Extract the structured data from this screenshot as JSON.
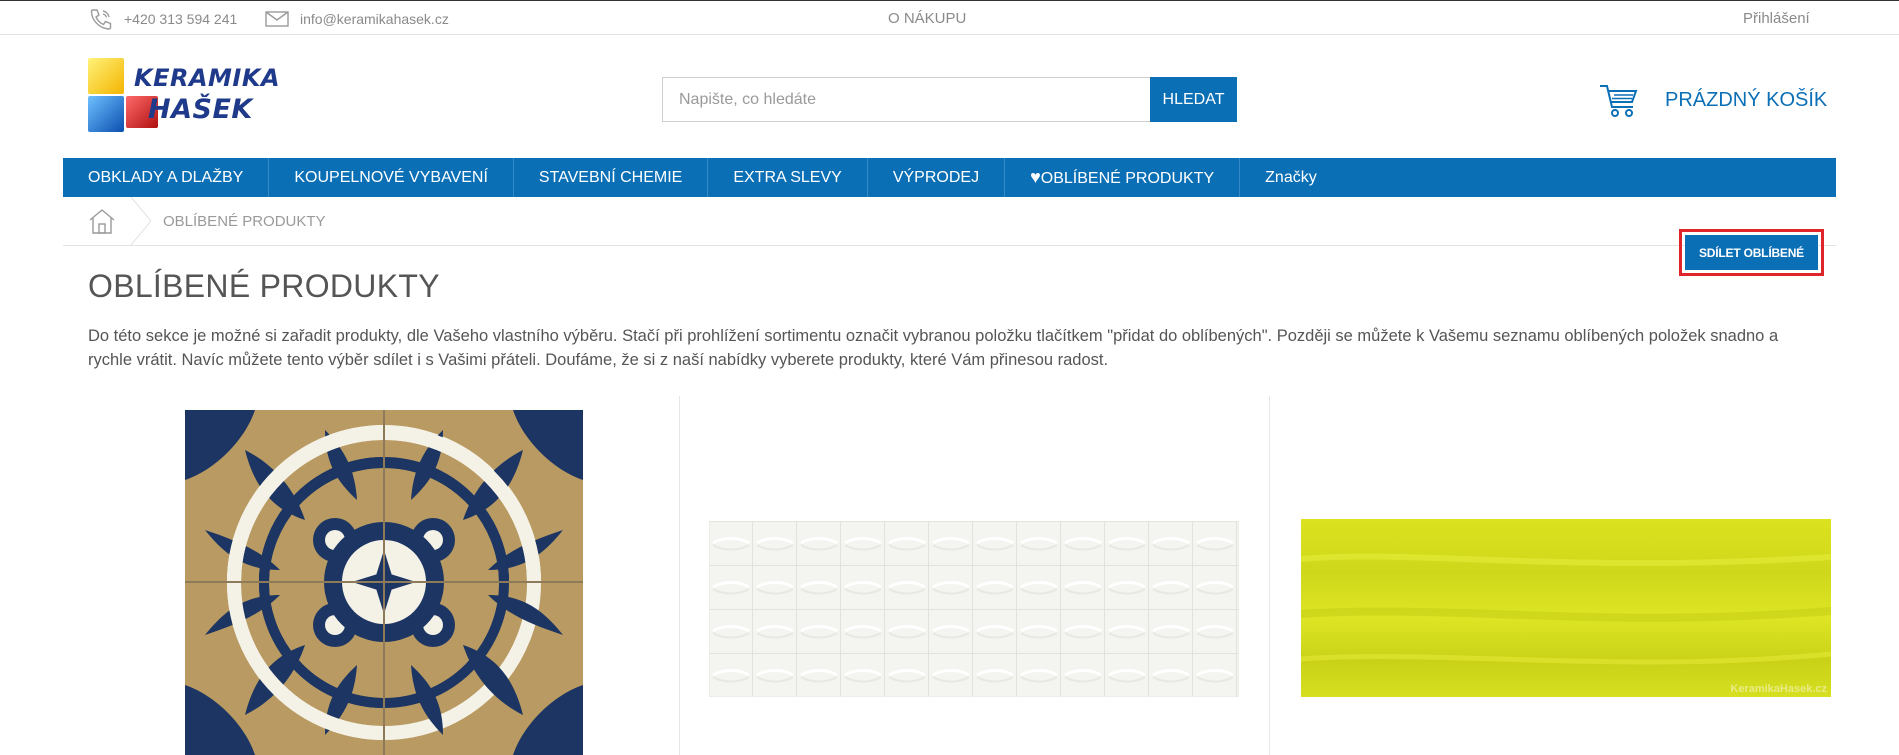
{
  "topbar": {
    "phone": "+420 313 594 241",
    "email": "info@keramikahasek.cz",
    "about": "O NÁKUPU",
    "login": "Přihlášení"
  },
  "logo": {
    "line1": "KERAMIKA",
    "line2": "HAŠEK"
  },
  "search": {
    "placeholder": "Napište, co hledáte",
    "button": "HLEDAT"
  },
  "cart": {
    "label": "PRÁZDNÝ KOŠÍK"
  },
  "nav": {
    "items": [
      "OBKLADY A DLAŽBY",
      "KOUPELNOVÉ VYBAVENÍ",
      "STAVEBNÍ CHEMIE",
      "EXTRA SLEVY",
      "VÝPRODEJ",
      "OBLÍBENÉ PRODUKTY",
      "Značky"
    ]
  },
  "breadcrumb": {
    "current": "OBLÍBENÉ PRODUKTY"
  },
  "share_button": "SDÍLET OBLÍBENÉ",
  "page": {
    "title": "OBLÍBENÉ PRODUKTY",
    "intro": "Do této sekce je možné si zařadit produkty, dle Vašeho vlastního výběru. Stačí při prohlížení sortimentu označit vybranou položku tlačítkem \"přidat do oblíbených\". Později se můžete k Vašemu seznamu oblíbených položek snadno a rychle vrátit. Navíc můžete tento výběr sdílet i s Vašimi přáteli. Doufáme, že si z naší nabídky vyberete produkty, které Vám přinesou radost."
  },
  "products": {
    "watermark": "KeramikaHasek.cz",
    "items": [
      {
        "image": "patterned-tile",
        "colors": [
          "#1c3562",
          "#b89a62",
          "#ffffff"
        ]
      },
      {
        "image": "white-3d-tile",
        "colors": [
          "#f4f4f0",
          "#e6e6e2"
        ]
      },
      {
        "image": "yellow-tile",
        "colors": [
          "#d8e020",
          "#c9d11a"
        ]
      }
    ]
  },
  "colors": {
    "brand_blue": "#0b6fb6",
    "highlight_red": "#e0242b",
    "logo_navy": "#1f3a8a"
  }
}
